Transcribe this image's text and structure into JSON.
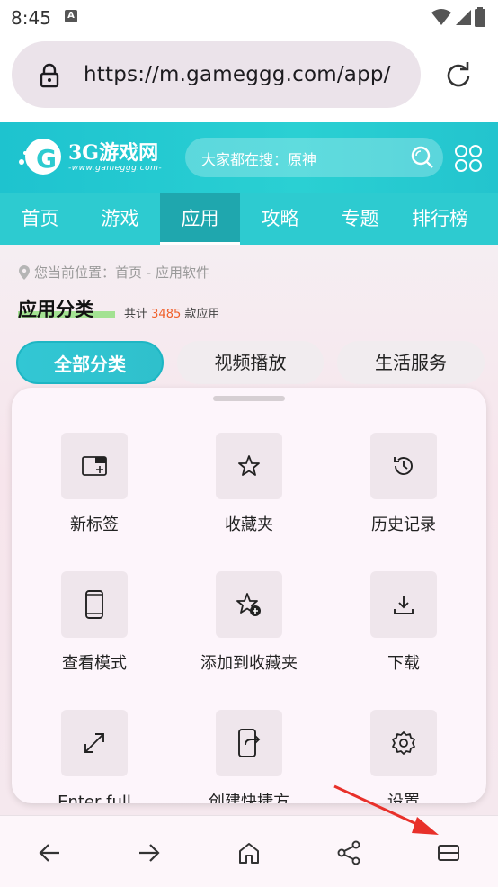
{
  "status_bar": {
    "time": "8:45",
    "notification_badge": "A"
  },
  "address_bar": {
    "url": "https://m.gameggg.com/app/"
  },
  "site": {
    "logo_text": "3G游戏网",
    "logo_sub": "-www.gameggg.com-",
    "search_hint": "大家都在搜：原神",
    "nav": [
      "首页",
      "游戏",
      "应用",
      "攻略",
      "专题",
      "排行榜"
    ],
    "active_nav": "应用",
    "breadcrumb": "您当前位置：首页 - 应用软件",
    "category_title": "应用分类",
    "count_prefix": "共计",
    "count_value": "3485",
    "count_suffix": "款应用",
    "chips": [
      "全部分类",
      "视频播放",
      "生活服务"
    ]
  },
  "menu": {
    "items": [
      {
        "label": "新标签",
        "icon": "new-tab-icon"
      },
      {
        "label": "收藏夹",
        "icon": "star-icon"
      },
      {
        "label": "历史记录",
        "icon": "history-icon"
      },
      {
        "label": "查看模式",
        "icon": "phone-icon"
      },
      {
        "label": "添加到收藏夹",
        "icon": "star-add-icon"
      },
      {
        "label": "下载",
        "icon": "download-icon"
      },
      {
        "label": "Enter full",
        "icon": "fullscreen-icon"
      },
      {
        "label": "创建快捷方",
        "icon": "shortcut-icon"
      },
      {
        "label": "设置",
        "icon": "settings-icon"
      }
    ]
  },
  "toolbar": {
    "buttons": [
      "back-icon",
      "forward-icon",
      "home-icon",
      "share-icon",
      "menu-icon"
    ]
  },
  "colors": {
    "accent": "#2dcbd0",
    "arrow": "#e8302a",
    "count": "#f0602a"
  }
}
